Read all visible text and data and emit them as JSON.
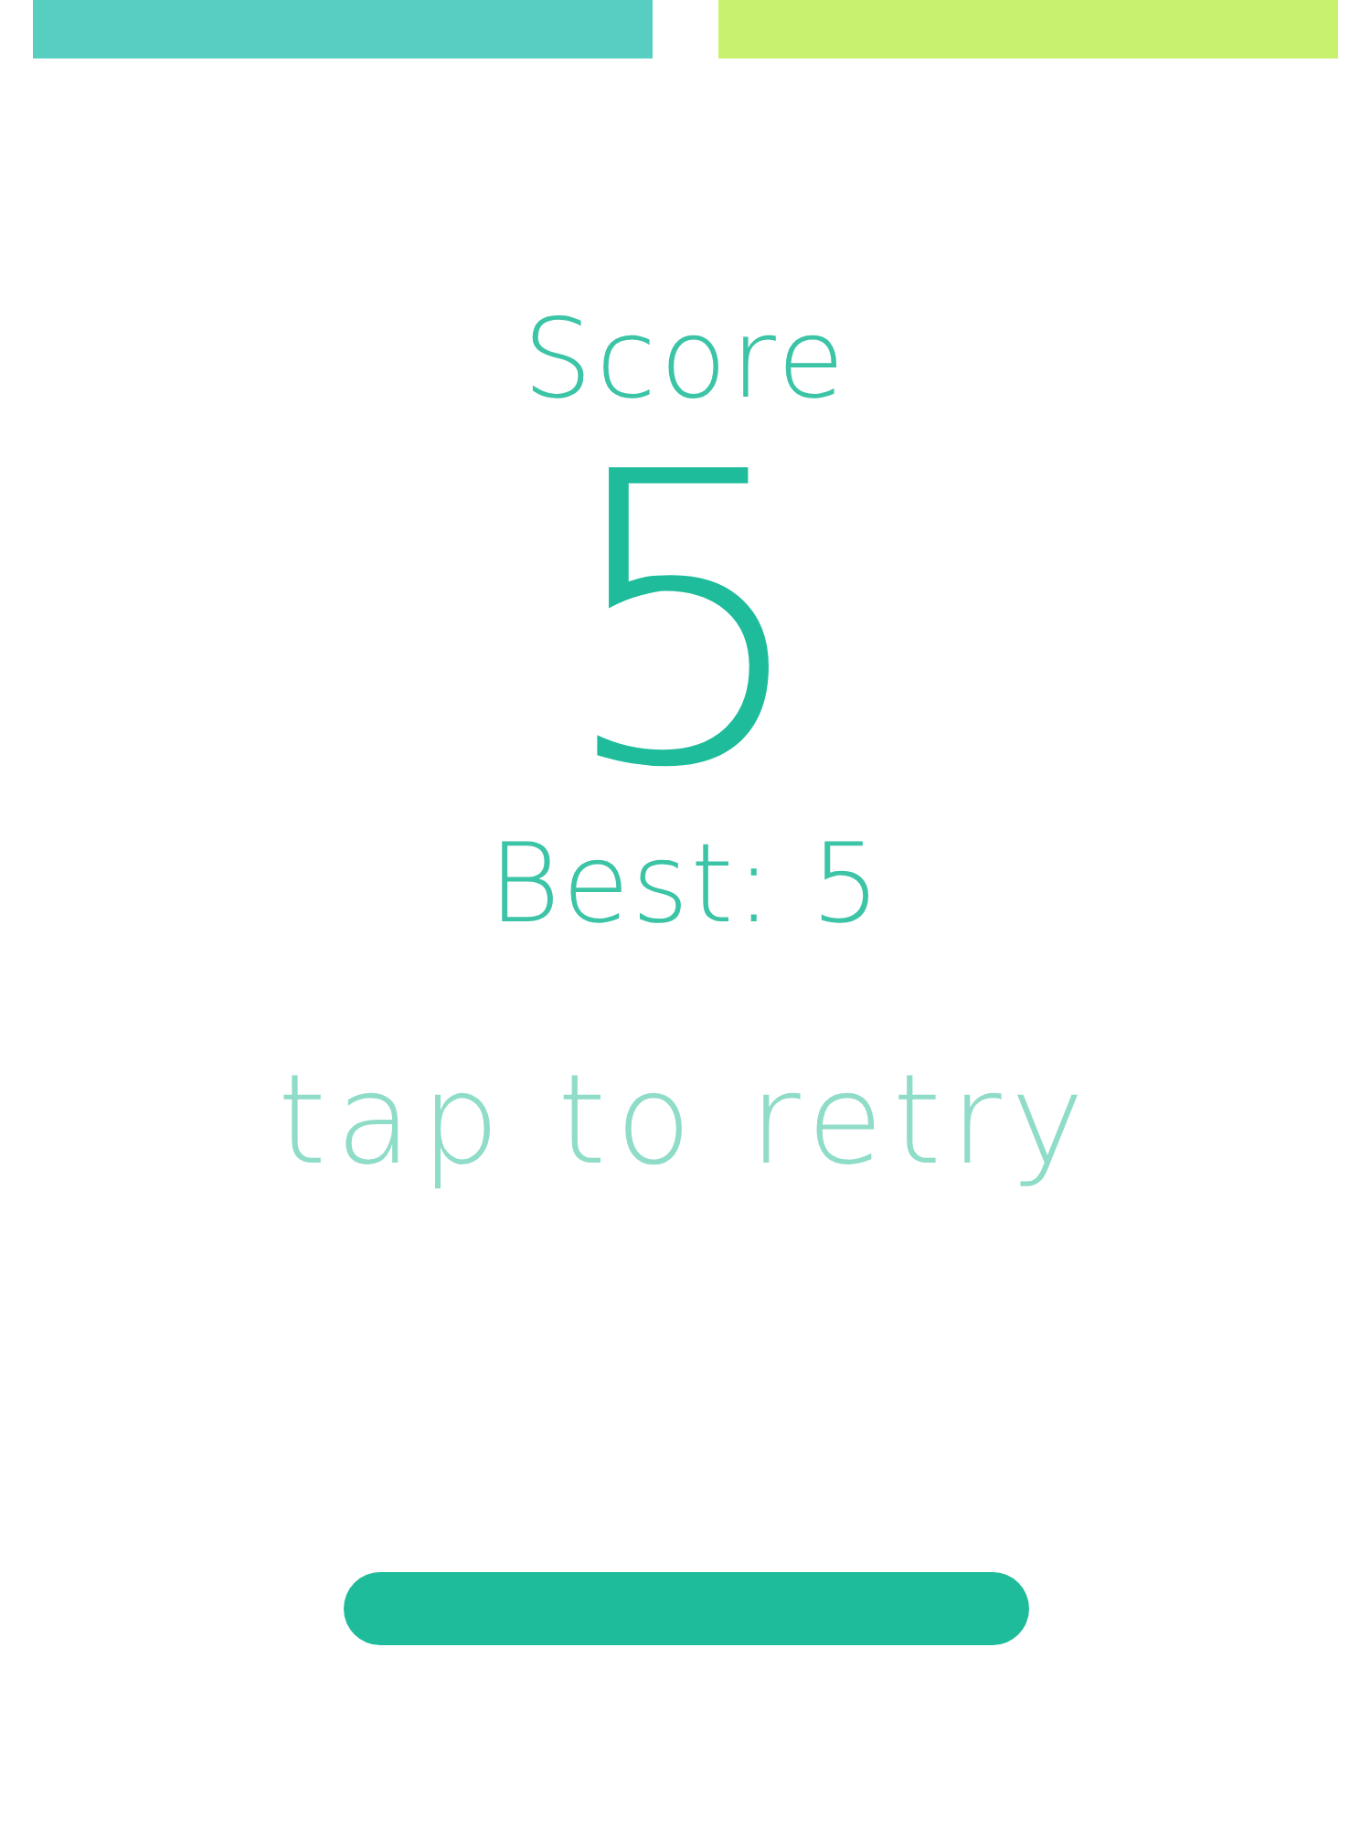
{
  "top_bars": [
    {
      "color": "#56cfc1"
    },
    {
      "color": "#c8f26e"
    }
  ],
  "score_label": "Score",
  "score": "5",
  "best": "Best: 5",
  "prompt": "tap to retry"
}
